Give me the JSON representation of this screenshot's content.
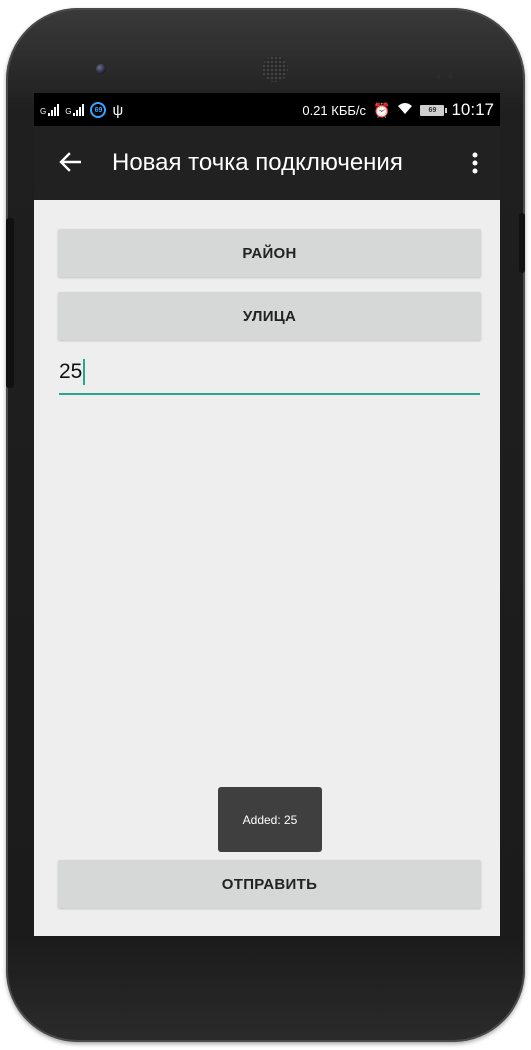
{
  "status_bar": {
    "signal_1_label": "G",
    "signal_2_label": "G",
    "badge": "69",
    "usb_icon": "usb-icon",
    "net_speed": "0.21 КББ/с",
    "battery_level": "69",
    "time": "10:17"
  },
  "app_bar": {
    "title": "Новая точка подключения",
    "back_icon": "arrow-back-icon",
    "overflow_icon": "more-vert-icon"
  },
  "form": {
    "district_button": "РАЙОН",
    "street_button": "УЛИЦА",
    "house_input_value": "25",
    "send_button": "ОТПРАВИТЬ"
  },
  "toast": {
    "message": "Added: 25"
  },
  "colors": {
    "accent": "#2ba58d",
    "app_bar": "#212121",
    "background": "#eeeeee",
    "button": "#d6d7d7",
    "toast": "#3f3f3f"
  }
}
